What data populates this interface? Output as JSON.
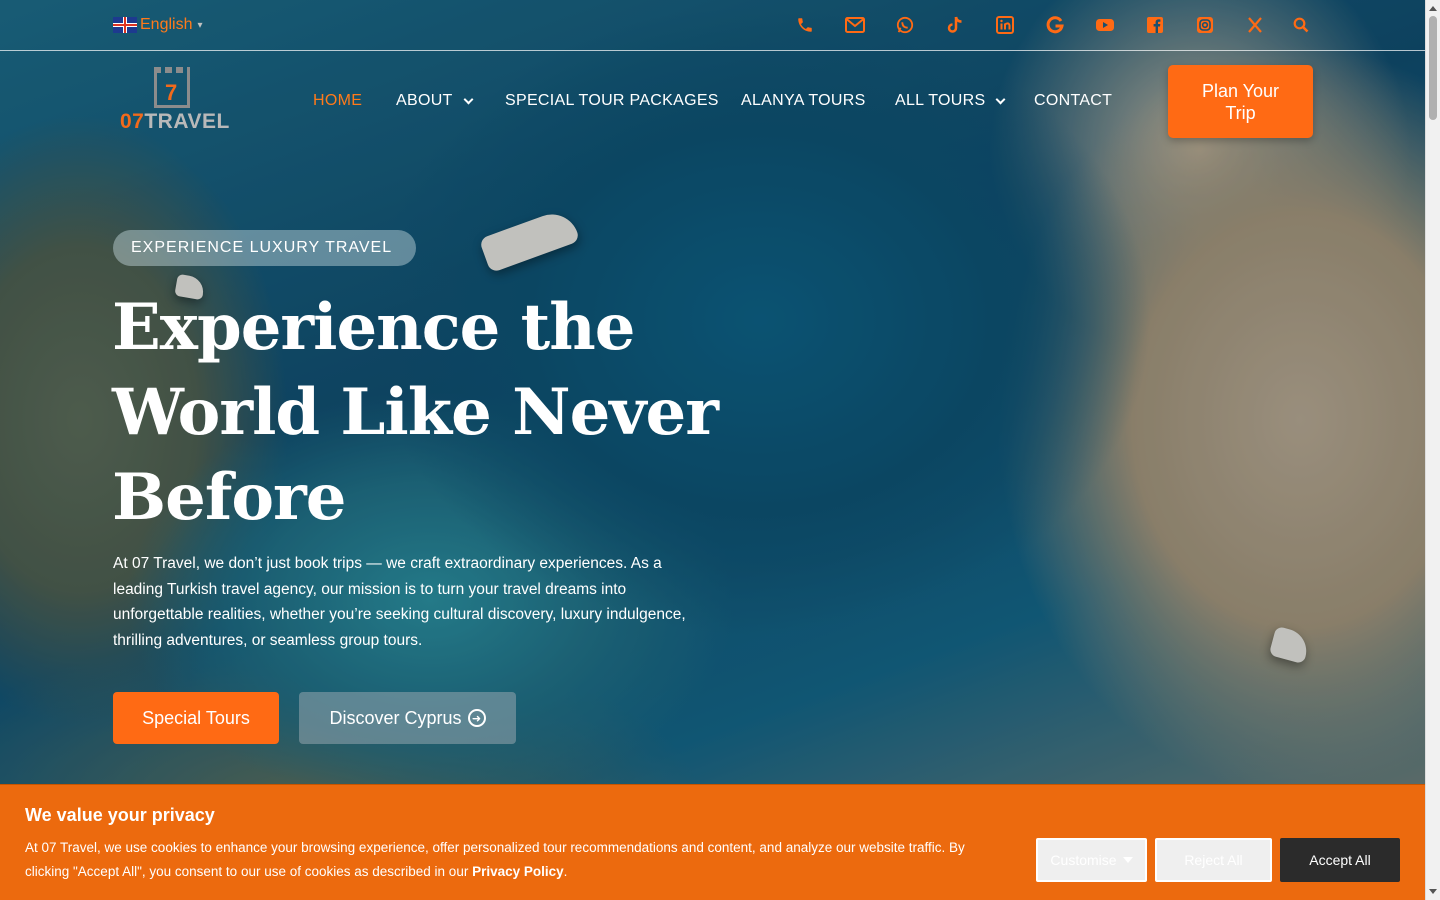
{
  "topbar": {
    "language": "English",
    "language_caret": "▾",
    "social_icons": [
      "phone-icon",
      "mail-icon",
      "whatsapp-icon",
      "tiktok-icon",
      "linkedin-icon",
      "google-icon",
      "youtube-icon",
      "facebook-icon",
      "instagram-icon",
      "x-icon",
      "search-icon"
    ]
  },
  "logo": {
    "seven": "7",
    "number": "07",
    "word": "TRAVEL"
  },
  "nav": {
    "home": "HOME",
    "about": "ABOUT",
    "special": "SPECIAL TOUR PACKAGES",
    "alanya": "ALANYA TOURS",
    "all_tours": "ALL TOURS",
    "contact": "CONTACT"
  },
  "plan_button": "Plan Your Trip",
  "hero": {
    "badge": "EXPERIENCE LUXURY TRAVEL",
    "title": "Experience the World Like Never Before",
    "text": "At 07 Travel, we don’t just book trips — we craft extraordinary experiences. As a leading Turkish travel agency, our mission is to turn your travel dreams into unforgettable realities, whether you’re seeking cultural discovery, luxury indulgence, thrilling adventures, or seamless group tours.",
    "primary_button": "Special Tours",
    "secondary_button": "Discover Cyprus"
  },
  "cookie": {
    "title": "We value your privacy",
    "text": "At 07 Travel, we use cookies to enhance your browsing experience, offer personalized tour recommendations and content, and analyze our website traffic. By clicking \"Accept All\", you consent to our use of cookies as described in our ",
    "link": "Privacy Policy",
    "link_suffix": ".",
    "customise": "Customise",
    "reject": "Reject All",
    "accept": "Accept All"
  },
  "colors": {
    "accent": "#ff6a14",
    "cookie_bg": "#ec6a0e",
    "accept_bg": "#2b2b2b"
  }
}
